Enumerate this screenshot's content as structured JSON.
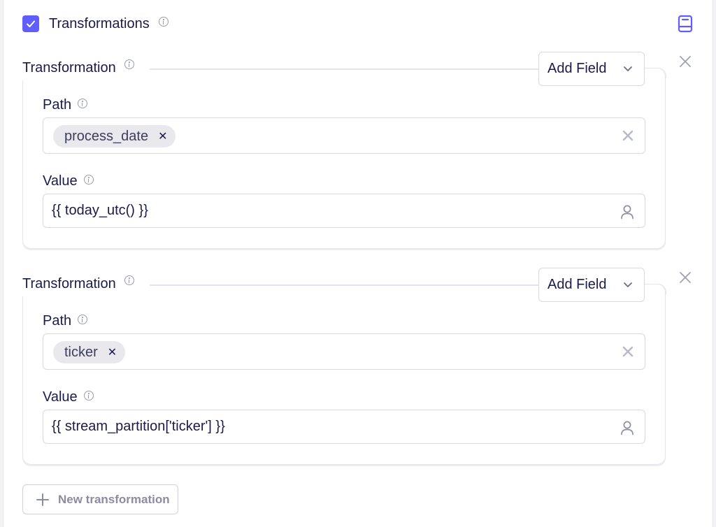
{
  "section": {
    "title": "Transformations",
    "checked": true,
    "accent_color": "#615eff"
  },
  "transformations": [
    {
      "label": "Transformation",
      "add_field_label": "Add Field",
      "path_label": "Path",
      "path_chip": "process_date",
      "value_label": "Value",
      "value": "{{ today_utc() }}"
    },
    {
      "label": "Transformation",
      "add_field_label": "Add Field",
      "path_label": "Path",
      "path_chip": "ticker",
      "value_label": "Value",
      "value": "{{ stream_partition['ticker'] }}"
    }
  ],
  "new_transformation_label": "New transformation",
  "icons": {
    "checkbox": "check-icon",
    "docs": "book-icon",
    "info": "info-icon",
    "remove": "close-icon",
    "dropdown": "chevron-down-icon",
    "clear": "clear-icon",
    "user_input": "user-icon",
    "add": "plus-icon"
  }
}
